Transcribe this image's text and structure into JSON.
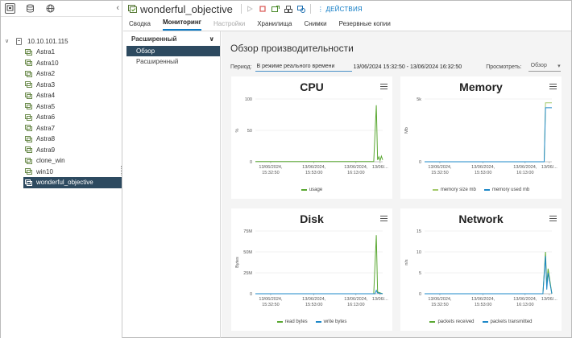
{
  "nav": {
    "host": "10.10.101.115",
    "vms": [
      "Astra1",
      "Astra10",
      "Astra2",
      "Astra3",
      "Astra4",
      "Astra5",
      "Astra6",
      "Astra7",
      "Astra8",
      "Astra9",
      "clone_win",
      "win10",
      "wonderful_objective"
    ],
    "selected_vm": "wonderful_objective"
  },
  "header": {
    "title": "wonderful_objective",
    "actions_label": "ДЕЙСТВИЯ"
  },
  "tabs": [
    {
      "label": "Сводка",
      "state": "normal"
    },
    {
      "label": "Мониторинг",
      "state": "active"
    },
    {
      "label": "Настройки",
      "state": "disabled"
    },
    {
      "label": "Хранилища",
      "state": "normal"
    },
    {
      "label": "Снимки",
      "state": "normal"
    },
    {
      "label": "Резервные копии",
      "state": "normal"
    }
  ],
  "subnav": {
    "heading": "Расширенный",
    "items": [
      {
        "label": "Обзор",
        "active": true
      },
      {
        "label": "Расширенный",
        "active": false
      }
    ]
  },
  "main": {
    "title": "Обзор производительности",
    "period_label": "Период:",
    "period_value": "В режиме реального времени",
    "period_range": "13/06/2024 15:32:50 - 13/06/2024 16:32:50",
    "view_label": "Просмотреть:",
    "view_value": "Обзор"
  },
  "colors": {
    "accent": "#0b79c4",
    "selected_bg": "#2d4a60",
    "series_green": "#5aa832",
    "series_green_light": "#a3c96a",
    "series_blue": "#1e88c8"
  },
  "chart_data": [
    {
      "type": "line",
      "title": "CPU",
      "ylabel": "%",
      "ylim": [
        0,
        100
      ],
      "yticks": [
        "100",
        "50",
        "0"
      ],
      "xticks": [
        "13/06/2024,\n15:32:50",
        "13/06/2024,\n15:53:00",
        "13/06/2024,\n16:13:00",
        "13/06/..."
      ],
      "series": [
        {
          "name": "usage",
          "color": "#5aa832",
          "points": [
            [
              0,
              0.3
            ],
            [
              0.93,
              0.3
            ],
            [
              0.95,
              90
            ],
            [
              0.96,
              3
            ],
            [
              0.97,
              8
            ],
            [
              0.98,
              2
            ],
            [
              0.99,
              9
            ],
            [
              1.0,
              3
            ]
          ]
        }
      ]
    },
    {
      "type": "line",
      "title": "Memory",
      "ylabel": "Mb",
      "ylim": [
        0,
        5000
      ],
      "yticks": [
        "5k",
        "0"
      ],
      "xticks": [
        "13/06/2024,\n15:32:50",
        "13/06/2024,\n15:53:00",
        "13/06/2024,\n16:13:00",
        "13/06/..."
      ],
      "series": [
        {
          "name": "memory size mb",
          "color": "#a3c96a",
          "points": [
            [
              0,
              0
            ],
            [
              0.94,
              0
            ],
            [
              0.95,
              4700
            ],
            [
              1.0,
              4700
            ]
          ]
        },
        {
          "name": "memory used mb",
          "color": "#1e88c8",
          "points": [
            [
              0,
              0
            ],
            [
              0.94,
              0
            ],
            [
              0.95,
              4300
            ],
            [
              1.0,
              4300
            ]
          ]
        }
      ]
    },
    {
      "type": "line",
      "title": "Disk",
      "ylabel": "Bytes",
      "ylim": [
        0,
        75000000
      ],
      "yticks": [
        "75M",
        "50M",
        "25M",
        "0"
      ],
      "xticks": [
        "13/06/2024,\n15:32:50",
        "13/06/2024,\n15:53:00",
        "13/06/2024,\n16:13:00",
        "13/06/..."
      ],
      "series": [
        {
          "name": "read bytes",
          "color": "#5aa832",
          "points": [
            [
              0,
              0
            ],
            [
              0.93,
              0
            ],
            [
              0.95,
              70000000
            ],
            [
              0.96,
              2000000
            ],
            [
              1.0,
              0
            ]
          ]
        },
        {
          "name": "write bytes",
          "color": "#1e88c8",
          "points": [
            [
              0,
              0
            ],
            [
              0.94,
              0
            ],
            [
              0.95,
              4000000
            ],
            [
              0.96,
              1000000
            ],
            [
              1.0,
              0
            ]
          ]
        }
      ]
    },
    {
      "type": "line",
      "title": "Network",
      "ylabel": "n/s",
      "ylim": [
        0,
        15
      ],
      "yticks": [
        "15",
        "10",
        "5",
        "0"
      ],
      "xticks": [
        "13/06/2024,\n15:32:50",
        "13/06/2024,\n15:53:00",
        "13/06/2024,\n16:13:00",
        "13/06/..."
      ],
      "series": [
        {
          "name": "packets received",
          "color": "#5aa832",
          "points": [
            [
              0,
              0
            ],
            [
              0.93,
              0
            ],
            [
              0.95,
              10
            ],
            [
              0.96,
              2
            ],
            [
              0.97,
              6
            ],
            [
              1.0,
              0
            ]
          ]
        },
        {
          "name": "packets transmitted",
          "color": "#1e88c8",
          "points": [
            [
              0,
              0
            ],
            [
              0.93,
              0
            ],
            [
              0.95,
              9
            ],
            [
              0.96,
              1
            ],
            [
              0.97,
              5
            ],
            [
              1.0,
              0
            ]
          ]
        }
      ]
    }
  ]
}
